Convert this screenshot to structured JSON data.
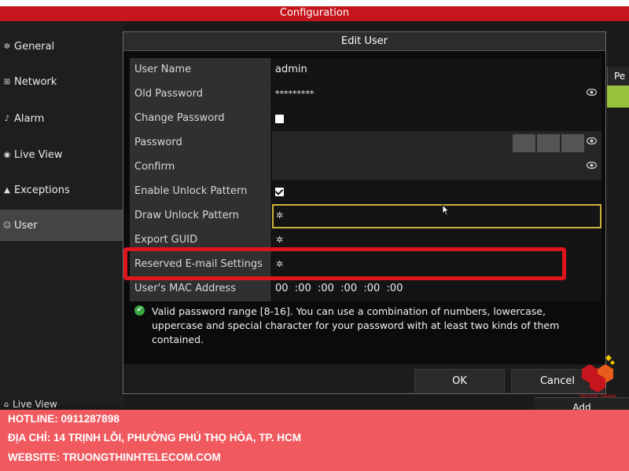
{
  "window": {
    "title": "Configuration"
  },
  "sidebar": {
    "items": [
      {
        "icon": "gear-icon",
        "label": "General"
      },
      {
        "icon": "network-icon",
        "label": "Network"
      },
      {
        "icon": "alarm-icon",
        "label": "Alarm"
      },
      {
        "icon": "eye-icon",
        "label": "Live View"
      },
      {
        "icon": "warning-icon",
        "label": "Exceptions"
      },
      {
        "icon": "users-icon",
        "label": "User",
        "active": true
      }
    ],
    "bottom_item": {
      "icon": "home-icon",
      "label": "Live View"
    }
  },
  "background_table": {
    "header_label": "Pe",
    "add_label": "Add",
    "row_highlight_color": "#9bc23c"
  },
  "dialog": {
    "title": "Edit User",
    "fields": {
      "user_name": {
        "label": "User Name",
        "value": "admin"
      },
      "old_password": {
        "label": "Old Password",
        "value": "*********"
      },
      "change_password": {
        "label": "Change Password",
        "checked": false
      },
      "password": {
        "label": "Password",
        "value": ""
      },
      "confirm": {
        "label": "Confirm",
        "value": ""
      },
      "enable_unlock_pattern": {
        "label": "Enable Unlock Pattern",
        "checked": true
      },
      "draw_unlock_pattern": {
        "label": "Draw Unlock Pattern"
      },
      "export_guid": {
        "label": "Export GUID"
      },
      "reserved_email": {
        "label": "Reserved E-mail Settings"
      },
      "mac_address": {
        "label": "User's MAC Address",
        "value": "00  :00  :00  :00  :00  :00"
      }
    },
    "info_text": "Valid password range [8-16]. You can use a combination of numbers, lowercase, uppercase and special character for your password with at least two kinds of them contained.",
    "ok_label": "OK",
    "cancel_label": "Cancel"
  },
  "watermark": {
    "text": "TRUONG THINH"
  },
  "footer": {
    "hotline": "HOTLINE: 0911287898",
    "address": "ĐỊA CHỈ: 14 TRỊNH LỖI, PHƯỜNG PHÚ THỌ HÒA, TP. HCM",
    "website": "WEBSITE: TRUONGTHINHTELECOM.COM"
  },
  "colors": {
    "title_bar": "#c4161c",
    "highlight_border": "#e0141c",
    "footer_bg": "#f05a5f",
    "info_icon": "#39a845",
    "pattern_border": "#c8b43c"
  }
}
